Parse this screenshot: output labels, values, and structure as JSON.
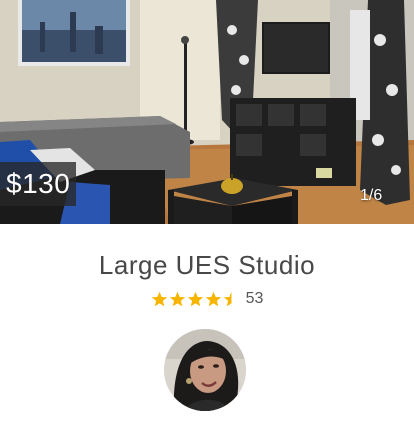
{
  "listing": {
    "price": "$130",
    "photo_counter": "1/6",
    "title": "Large UES Studio",
    "rating_stars": 4.5,
    "review_count": "53"
  },
  "colors": {
    "star": "#f7b500",
    "title_text": "#484848"
  },
  "icons": [
    "heart-icon",
    "star-icon",
    "half-star-icon"
  ]
}
